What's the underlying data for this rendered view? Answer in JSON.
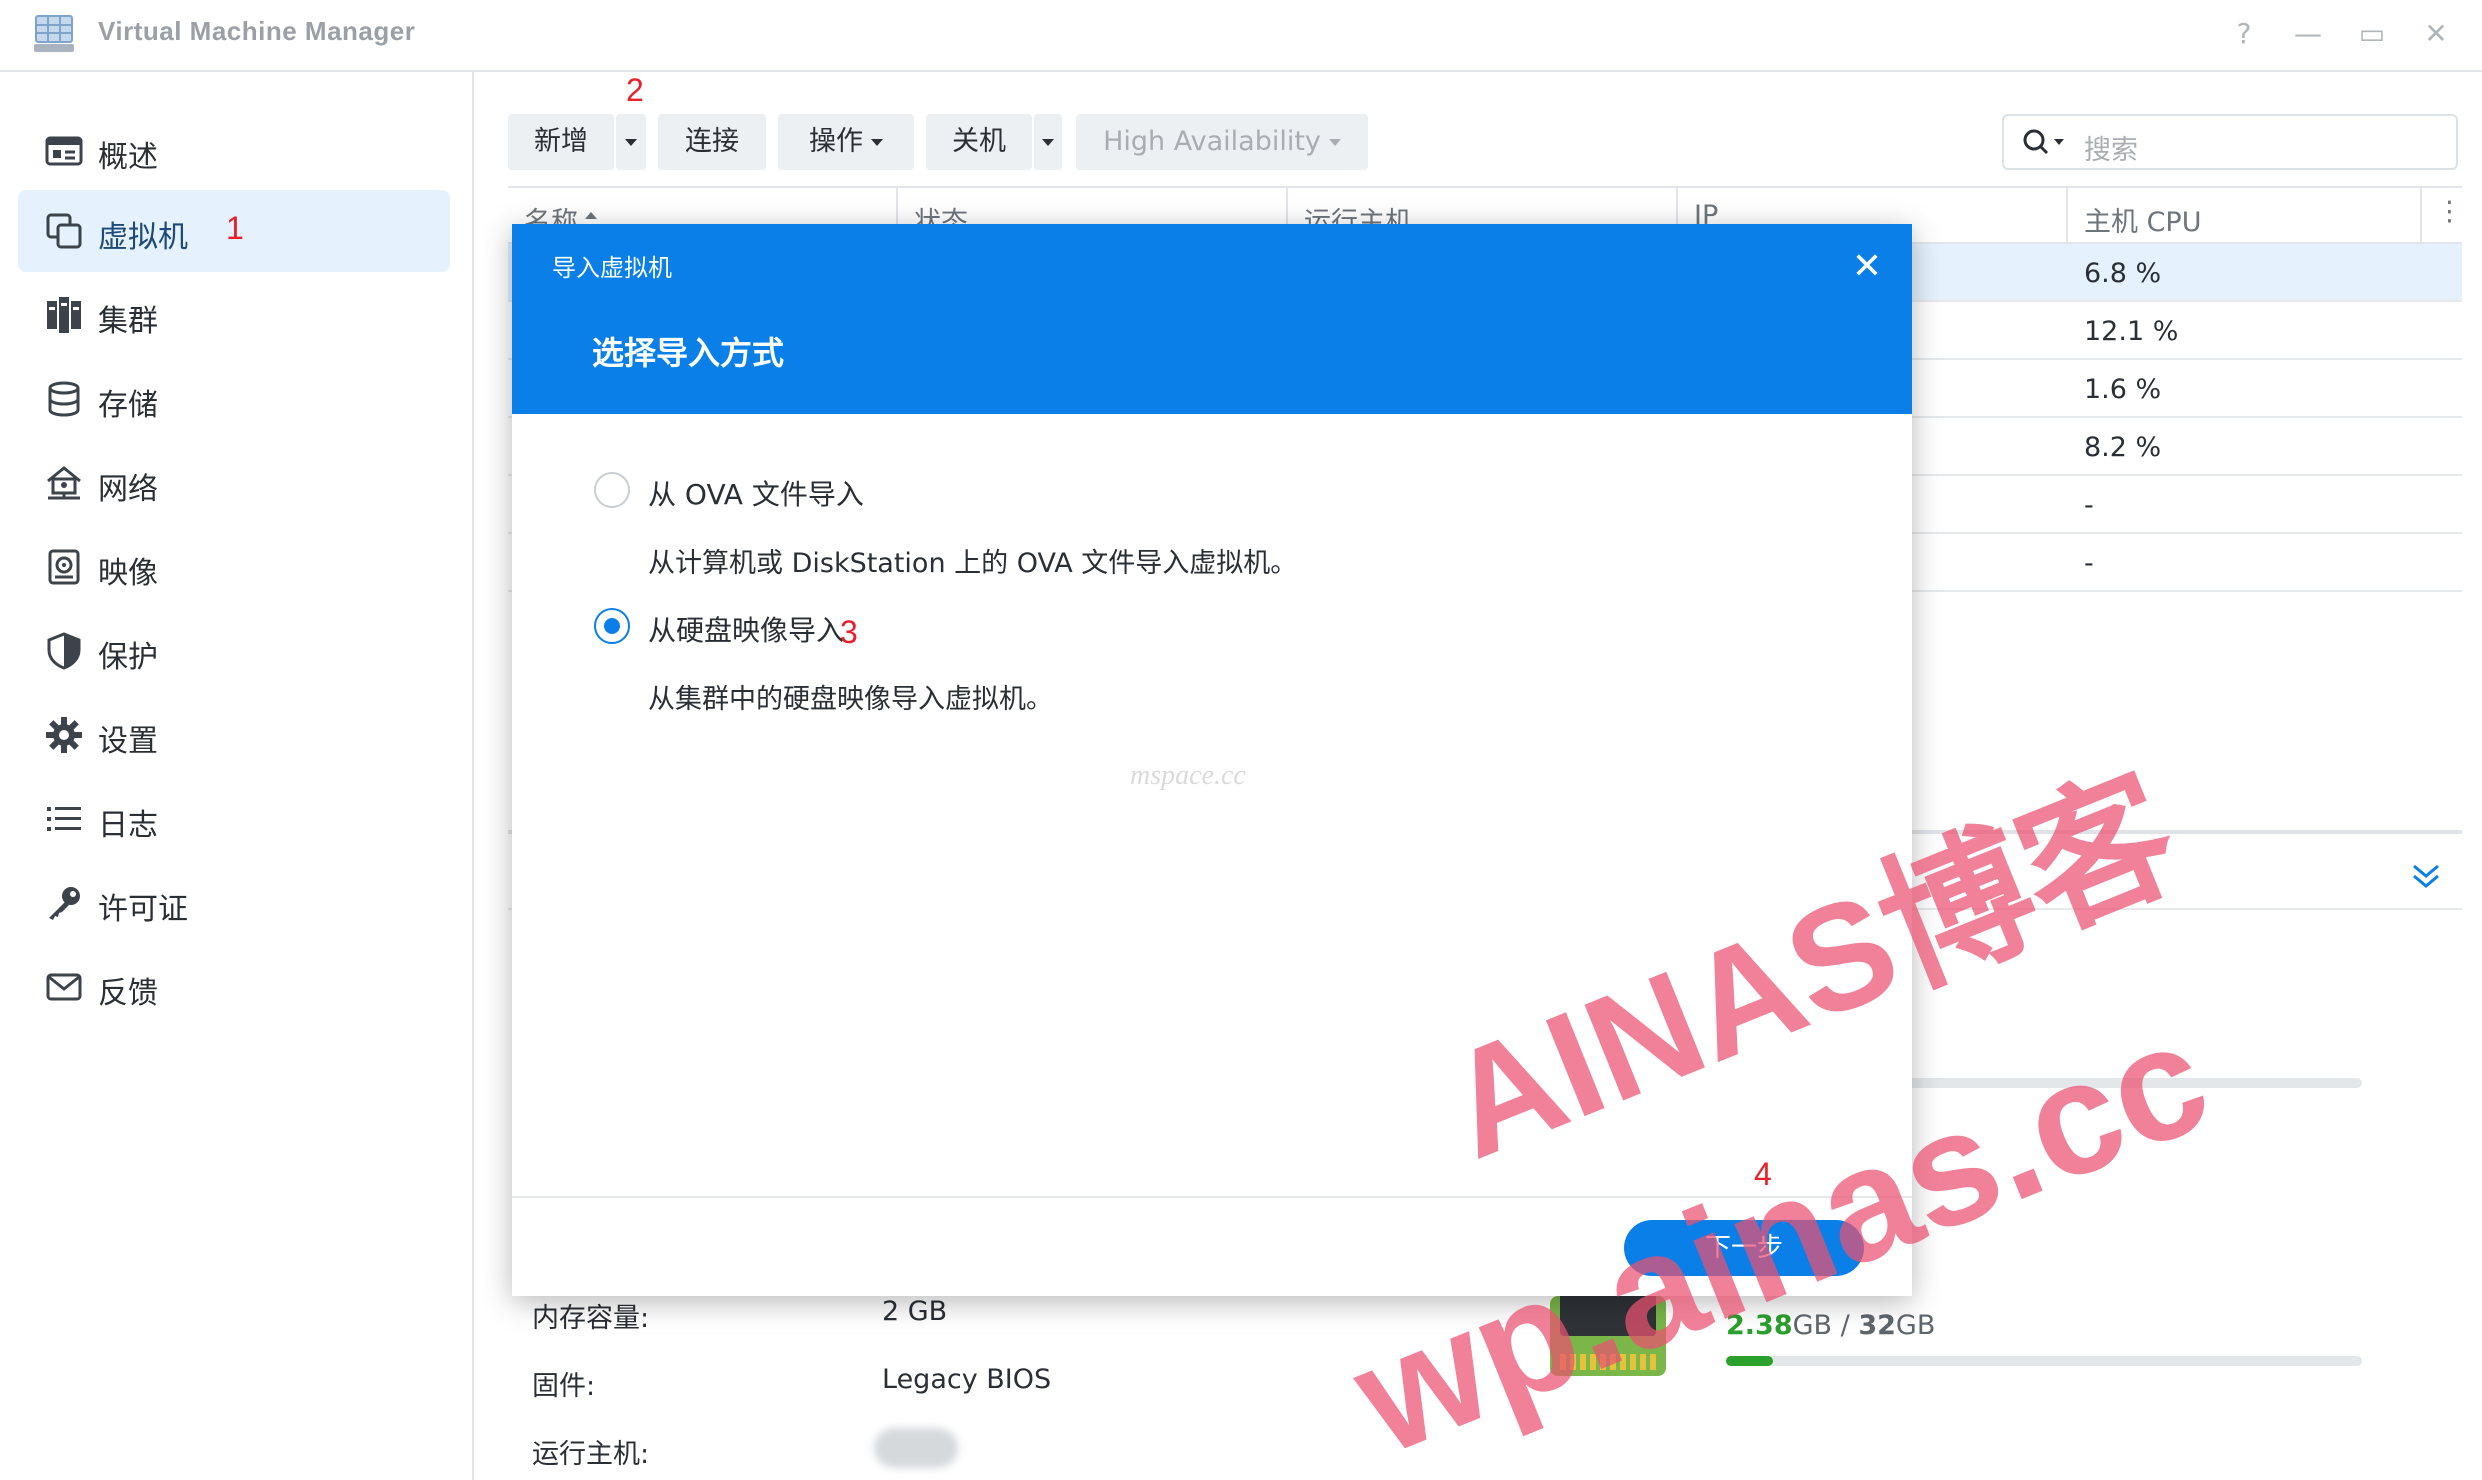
{
  "app": {
    "title": "Virtual Machine Manager"
  },
  "window_controls": {
    "help": "?",
    "minimize": "—",
    "maximize": "▭",
    "close": "✕"
  },
  "sidebar": {
    "items": [
      {
        "label": "概述",
        "icon": "overview-icon"
      },
      {
        "label": "虚拟机",
        "icon": "virtual-machine-icon",
        "active": true
      },
      {
        "label": "集群",
        "icon": "cluster-icon"
      },
      {
        "label": "存储",
        "icon": "storage-icon"
      },
      {
        "label": "网络",
        "icon": "network-icon"
      },
      {
        "label": "映像",
        "icon": "image-icon"
      },
      {
        "label": "保护",
        "icon": "shield-icon"
      },
      {
        "label": "设置",
        "icon": "gear-icon"
      },
      {
        "label": "日志",
        "icon": "log-list-icon"
      },
      {
        "label": "许可证",
        "icon": "key-icon"
      },
      {
        "label": "反馈",
        "icon": "mail-icon"
      }
    ]
  },
  "annotations": {
    "step1": "1",
    "step2": "2",
    "step3": "3",
    "step4": "4"
  },
  "toolbar": {
    "new_label": "新增",
    "connect_label": "连接",
    "action_label": "操作",
    "shutdown_label": "关机",
    "ha_label": "High Availability",
    "search_placeholder": "搜索"
  },
  "table": {
    "columns": [
      "名称",
      "状态",
      "运行主机",
      "IP",
      "主机 CPU"
    ],
    "rows": [
      {
        "cpu": "6.8 %"
      },
      {
        "cpu": "12.1 %"
      },
      {
        "cpu": "1.6 %"
      },
      {
        "cpu": "8.2 %"
      },
      {
        "cpu": "-"
      },
      {
        "cpu": "-"
      }
    ]
  },
  "details": {
    "memory_label": "内存容量:",
    "memory_value": "2 GB",
    "firmware_label": "固件:",
    "firmware_value": "Legacy BIOS",
    "host_label": "运行主机:",
    "mem_used": "2.38",
    "mem_used_unit": "GB",
    "mem_sep": " / ",
    "mem_total": "32",
    "mem_total_unit": "GB",
    "mem_fraction": 0.074
  },
  "dialog": {
    "title": "导入虚拟机",
    "subtitle": "选择导入方式",
    "options": [
      {
        "label": "从 OVA 文件导入",
        "desc": "从计算机或 DiskStation 上的 OVA 文件导入虚拟机。",
        "checked": false
      },
      {
        "label": "从硬盘映像导入",
        "desc": "从集群中的硬盘映像导入虚拟机。",
        "checked": true
      }
    ],
    "next_label": "下一步"
  },
  "watermarks": {
    "line1": "AINAS博客",
    "line2": "wp.ainas.cc",
    "faint": "mspace.cc"
  },
  "colors": {
    "accent": "#0a7fe8",
    "selected_row": "#e5f1fc",
    "annotation": "#e8202a",
    "watermark": "#ec5070",
    "memory_green": "#2ba02d"
  }
}
